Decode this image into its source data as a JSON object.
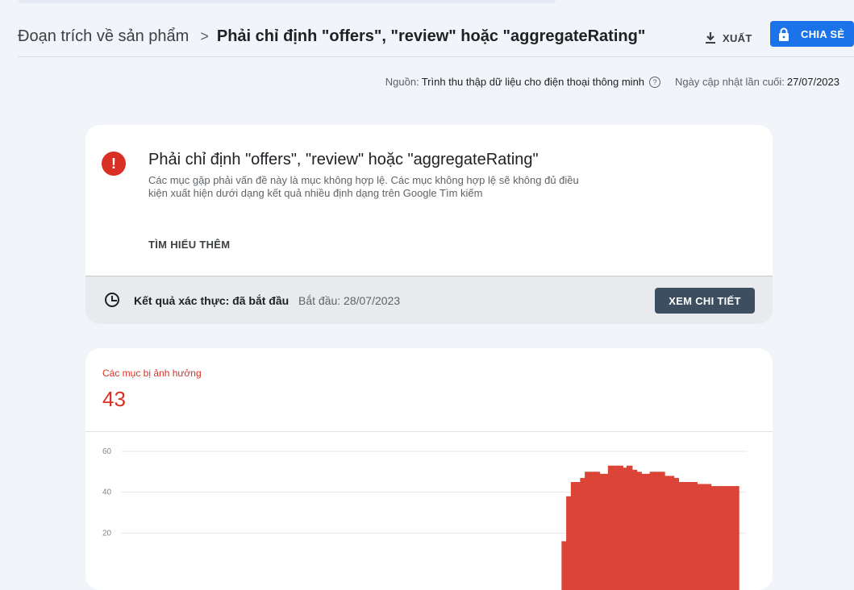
{
  "breadcrumb": {
    "parent": "Đoạn trích về sản phẩm",
    "separator": ">",
    "current": "Phải chỉ định \"offers\", \"review\" hoặc \"aggregateRating\""
  },
  "toolbar": {
    "export_label": "XUẤT",
    "share_label": "CHIA SẺ"
  },
  "meta": {
    "source_label": "Nguồn:",
    "source_value": "Trình thu thập dữ liệu cho điện thoại thông minh",
    "updated_label": "Ngày cập nhật lần cuối:",
    "updated_value": "27/07/2023"
  },
  "issue": {
    "title": "Phải chỉ định \"offers\", \"review\" hoặc \"aggregateRating\"",
    "description": "Các mục gặp phải vấn đề này là mục không hợp lệ. Các mục không hợp lệ sẽ không đủ điều kiện xuất hiện dưới dạng kết quả nhiều định dạng trên Google Tìm kiếm",
    "learn_more": "TÌM HIỂU THÊM",
    "validation_label": "Kết quả xác thực: đã bắt đầu",
    "validation_date": "Bắt đầu: 28/07/2023",
    "details_button": "XEM CHI TIẾT"
  },
  "summary": {
    "affected_label": "Các mục bị ảnh hưởng",
    "affected_count": "43"
  },
  "colors": {
    "accent": "#1a73e8",
    "error": "#d93025",
    "bar": "#db4437"
  },
  "chart_data": {
    "type": "bar",
    "yticks": [
      "60",
      "40",
      "20"
    ],
    "ylim": [
      0,
      60
    ],
    "values": [
      0,
      0,
      0,
      0,
      0,
      0,
      0,
      0,
      0,
      0,
      0,
      0,
      0,
      0,
      0,
      0,
      0,
      0,
      0,
      0,
      0,
      0,
      0,
      0,
      0,
      0,
      0,
      0,
      0,
      0,
      0,
      0,
      0,
      0,
      0,
      0,
      0,
      0,
      0,
      0,
      0,
      0,
      0,
      0,
      0,
      0,
      0,
      0,
      0,
      0,
      0,
      0,
      0,
      0,
      0,
      0,
      0,
      0,
      0,
      0,
      0,
      0,
      0,
      0,
      0,
      0,
      0,
      0,
      0,
      0,
      0,
      0,
      0,
      0,
      0,
      0,
      0,
      0,
      0,
      0,
      0,
      0,
      0,
      0,
      0,
      0,
      0,
      0,
      0,
      0,
      0,
      0,
      0,
      0,
      0,
      16,
      38,
      45,
      45,
      47,
      50,
      50,
      50,
      49,
      49,
      53,
      53,
      53,
      52,
      53,
      51,
      50,
      49,
      49,
      50,
      50,
      50,
      48,
      48,
      47,
      45,
      45,
      45,
      45,
      44,
      44,
      44,
      43,
      43,
      43,
      43,
      43,
      43
    ]
  }
}
